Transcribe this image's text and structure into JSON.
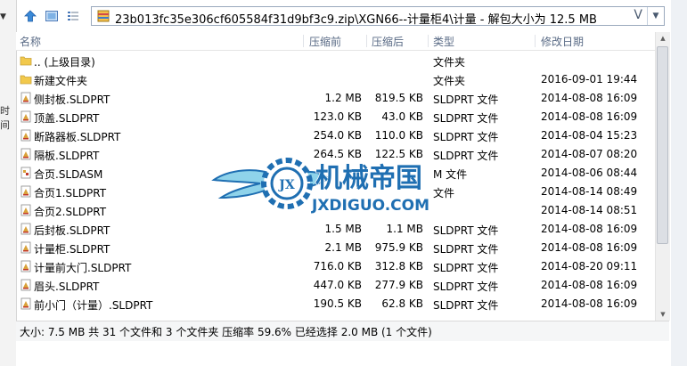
{
  "window": {
    "path": "23b013fc35e306cf605584f31d9bf3c9.zip\\XGN66--计量柜4\\计量 - 解包大小为 12.5 MB",
    "path_v": "V",
    "underlying_fragment": "时间"
  },
  "columns": {
    "name": "名称",
    "packed": "压缩前",
    "compressed": "压缩后",
    "type": "类型",
    "modified": "修改日期"
  },
  "rows": [
    {
      "icon": "folder-icon",
      "name": ".. (上级目录)",
      "packed": "",
      "compressed": "",
      "type": "文件夹",
      "modified": ""
    },
    {
      "icon": "folder-icon",
      "name": "新建文件夹",
      "packed": "",
      "compressed": "",
      "type": "文件夹",
      "modified": "2016-09-01 19:44"
    },
    {
      "icon": "sldprt-file-icon",
      "name": "侧封板.SLDPRT",
      "packed": "1.2 MB",
      "compressed": "819.5 KB",
      "type": "SLDPRT 文件",
      "modified": "2014-08-08 16:09"
    },
    {
      "icon": "sldprt-file-icon",
      "name": "顶盖.SLDPRT",
      "packed": "123.0 KB",
      "compressed": "43.0 KB",
      "type": "SLDPRT 文件",
      "modified": "2014-08-08 16:09"
    },
    {
      "icon": "sldprt-file-icon",
      "name": "断路器板.SLDPRT",
      "packed": "254.0 KB",
      "compressed": "110.0 KB",
      "type": "SLDPRT 文件",
      "modified": "2014-08-04 15:23"
    },
    {
      "icon": "sldprt-file-icon",
      "name": "隔板.SLDPRT",
      "packed": "264.5 KB",
      "compressed": "122.5 KB",
      "type": "SLDPRT 文件",
      "modified": "2014-08-07 08:20"
    },
    {
      "icon": "sldasm-file-icon",
      "name": "合页.SLDASM",
      "packed": "",
      "compressed": "",
      "type": "M 文件",
      "modified": "2014-08-06 08:44"
    },
    {
      "icon": "sldprt-file-icon",
      "name": "合页1.SLDPRT",
      "packed": "",
      "compressed": "",
      "type": "文件",
      "modified": "2014-08-14 08:49"
    },
    {
      "icon": "sldprt-file-icon",
      "name": "合页2.SLDPRT",
      "packed": "",
      "compressed": "",
      "type": "",
      "modified": "2014-08-14 08:51"
    },
    {
      "icon": "sldprt-file-icon",
      "name": "后封板.SLDPRT",
      "packed": "1.5 MB",
      "compressed": "1.1 MB",
      "type": "SLDPRT 文件",
      "modified": "2014-08-08 16:09"
    },
    {
      "icon": "sldprt-file-icon",
      "name": "计量柜.SLDPRT",
      "packed": "2.1 MB",
      "compressed": "975.9 KB",
      "type": "SLDPRT 文件",
      "modified": "2014-08-08 16:09"
    },
    {
      "icon": "sldprt-file-icon",
      "name": "计量前大门.SLDPRT",
      "packed": "716.0 KB",
      "compressed": "312.8 KB",
      "type": "SLDPRT 文件",
      "modified": "2014-08-20 09:11"
    },
    {
      "icon": "sldprt-file-icon",
      "name": "眉头.SLDPRT",
      "packed": "447.0 KB",
      "compressed": "277.9 KB",
      "type": "SLDPRT 文件",
      "modified": "2014-08-08 16:09"
    },
    {
      "icon": "sldprt-file-icon",
      "name": "前小门（计量）.SLDPRT",
      "packed": "190.5 KB",
      "compressed": "62.8 KB",
      "type": "SLDPRT 文件",
      "modified": "2014-08-08 16:09"
    }
  ],
  "status": {
    "text": "大小: 7.5 MB 共 31 个文件和 3 个文件夹 压缩率 59.6% 已经选择 2.0 MB (1 个文件)"
  },
  "watermark": {
    "title": "机械帝国",
    "domain": "JXDIGUO.COM",
    "badge": "JX"
  },
  "colors": {
    "header_text": "#5a6b86",
    "path_border": "#9aa9bd",
    "watermark_blue": "#1f6fb2",
    "watermark_cyan": "#8fd3ea"
  }
}
